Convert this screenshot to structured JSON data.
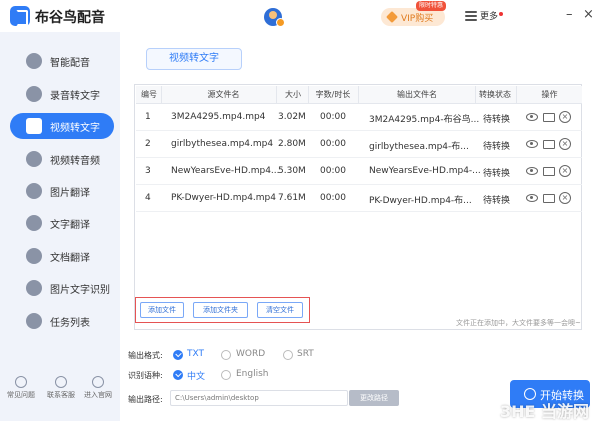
{
  "app": {
    "title": "布谷鸟配音",
    "vip_label": "VIP购买",
    "vip_tag": "限时特惠",
    "more_label": "更多",
    "minimize": "–",
    "close": "×"
  },
  "sidebar": {
    "items": [
      {
        "label": "智能配音",
        "icon": "smart-dub-icon"
      },
      {
        "label": "录音转文字",
        "icon": "recording-icon"
      },
      {
        "label": "视频转文字",
        "icon": "video-text-icon",
        "active": true
      },
      {
        "label": "视频转音频",
        "icon": "video-audio-icon"
      },
      {
        "label": "图片翻译",
        "icon": "image-translate-icon"
      },
      {
        "label": "文字翻译",
        "icon": "text-translate-icon"
      },
      {
        "label": "文档翻译",
        "icon": "doc-translate-icon"
      },
      {
        "label": "图片文字识别",
        "icon": "ocr-icon"
      },
      {
        "label": "任务列表",
        "icon": "task-list-icon"
      }
    ],
    "footer": [
      {
        "label": "常见问题",
        "icon": "question-icon"
      },
      {
        "label": "联系客服",
        "icon": "support-icon"
      },
      {
        "label": "进入官网",
        "icon": "website-icon"
      }
    ]
  },
  "main": {
    "tab_label": "视频转文字",
    "table": {
      "headers": [
        "编号",
        "源文件名",
        "大小",
        "字数/时长",
        "输出文件名",
        "转换状态",
        "操作"
      ],
      "rows": [
        {
          "no": "1",
          "source": "3M2A4295.mp4.mp4",
          "size": "3.02M",
          "duration": "00:00",
          "output": "3M2A4295.mp4-布谷鸟...",
          "status": "待转换"
        },
        {
          "no": "2",
          "source": "girlbythesea.mp4.mp4",
          "size": "2.80M",
          "duration": "00:00",
          "output": "girlbythesea.mp4-布...",
          "status": "待转换"
        },
        {
          "no": "3",
          "source": "NewYearsEve-HD.mp4...",
          "size": "5.30M",
          "duration": "00:00",
          "output": "NewYearsEve-HD.mp4-...",
          "status": "待转换"
        },
        {
          "no": "4",
          "source": "PK-Dwyer-HD.mp4.mp4",
          "size": "7.61M",
          "duration": "00:00",
          "output": "PK-Dwyer-HD.mp4-布...",
          "status": "待转换"
        }
      ]
    },
    "buttons": {
      "add_file": "添加文件",
      "add_folder": "添加文件夹",
      "clear": "清空文件"
    },
    "hint": "文件正在添加中，大文件要多等一会噢~",
    "output_format": {
      "label": "输出格式:",
      "options": [
        "TXT",
        "WORD",
        "SRT"
      ],
      "selected": "TXT"
    },
    "language": {
      "label": "识别语种:",
      "options": [
        "中文",
        "English"
      ],
      "selected": "中文"
    },
    "output_path": {
      "label": "输出路径:",
      "value": "C:\\Users\\admin\\desktop",
      "change_label": "更改路径"
    },
    "start_label": "开始转换",
    "colors": {
      "accent": "#2f7cf6",
      "sidebar_bg": "#f0f3fa",
      "highlight_border": "#e55353"
    }
  },
  "watermark": "3HE 当游网"
}
